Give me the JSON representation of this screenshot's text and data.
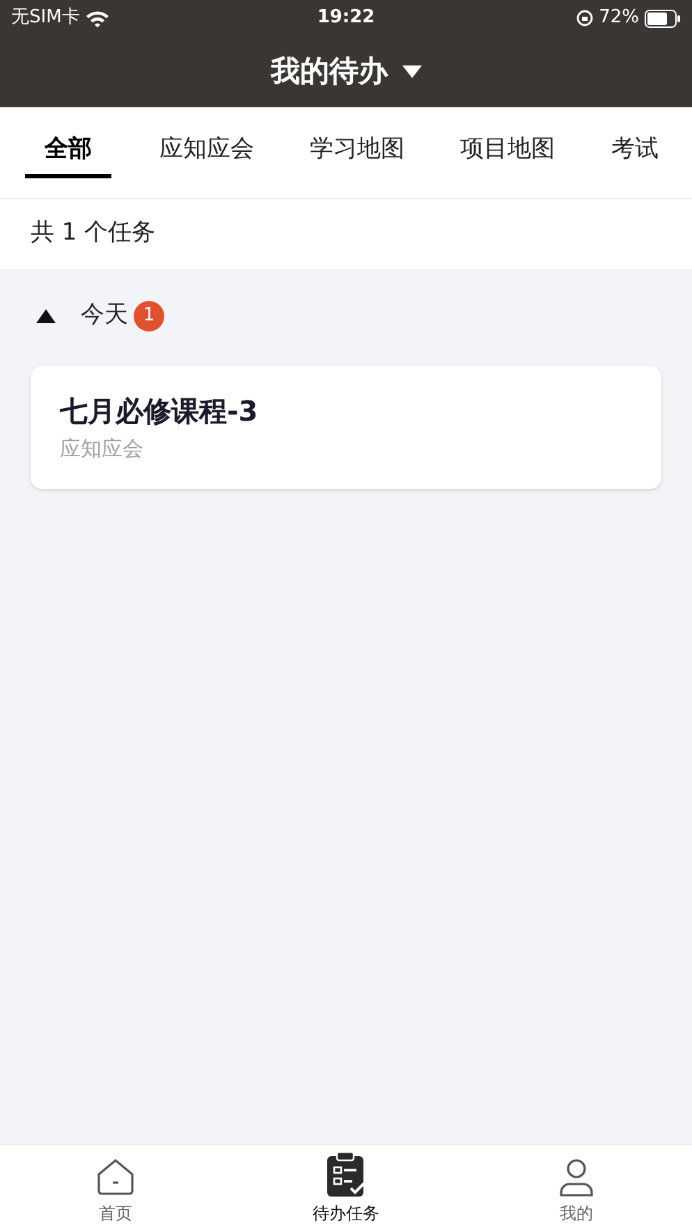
{
  "status_bar": {
    "carrier": "无SIM卡",
    "time": "19:22",
    "battery": "72%"
  },
  "header": {
    "title": "我的待办"
  },
  "tabs": [
    {
      "label": "全部",
      "selected": true
    },
    {
      "label": "应知应会",
      "selected": false
    },
    {
      "label": "学习地图",
      "selected": false
    },
    {
      "label": "项目地图",
      "selected": false
    },
    {
      "label": "考试",
      "selected": false
    }
  ],
  "summary": "共 1 个任务",
  "groups": [
    {
      "label": "今天",
      "count": "1",
      "expanded": true,
      "tasks": [
        {
          "title": "七月必修课程-3",
          "category": "应知应会"
        }
      ]
    }
  ],
  "bottom_nav": [
    {
      "label": "首页",
      "kind": "home",
      "selected": false
    },
    {
      "label": "待办任务",
      "kind": "tasks",
      "selected": true
    },
    {
      "label": "我的",
      "kind": "profile",
      "selected": false
    }
  ]
}
